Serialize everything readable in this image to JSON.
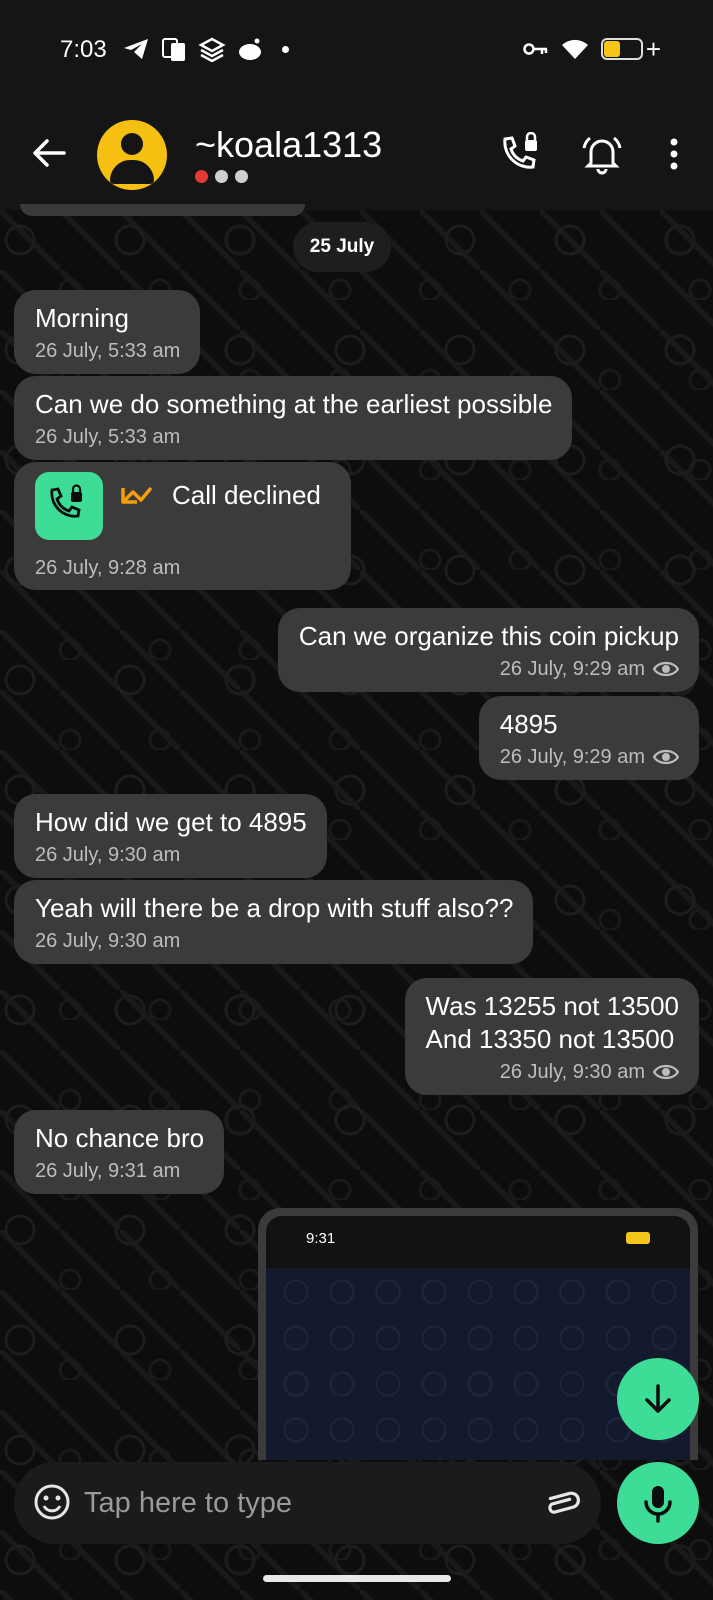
{
  "status_bar": {
    "time": "7:03"
  },
  "header": {
    "contact_name": "~koala1313"
  },
  "date_chip": "25 July",
  "messages": [
    {
      "dir": "in",
      "text": "Morning",
      "time": "26 July, 5:33 am"
    },
    {
      "dir": "in",
      "text": "Can we do something at the earliest possible",
      "time": "26 July, 5:33 am"
    },
    {
      "dir": "in",
      "type": "call",
      "text": "Call declined",
      "time": "26 July, 9:28 am"
    },
    {
      "dir": "out",
      "text": "Can we organize this coin pickup",
      "time": "26 July, 9:29 am",
      "seen": true
    },
    {
      "dir": "out",
      "text": "4895",
      "time": "26 July, 9:29 am",
      "seen": true
    },
    {
      "dir": "in",
      "text": "How did we get to 4895",
      "time": "26 July, 9:30 am"
    },
    {
      "dir": "in",
      "text": "Yeah will there be a drop with stuff also??",
      "time": "26 July, 9:30 am"
    },
    {
      "dir": "out",
      "text": "Was 13255 not 13500\nAnd 13350 not 13500",
      "time": "26 July, 9:30 am",
      "seen": true
    },
    {
      "dir": "in",
      "text": "No chance bro",
      "time": "26 July, 9:31 am"
    },
    {
      "dir": "out",
      "type": "image",
      "status_time": "9:31"
    }
  ],
  "composer": {
    "placeholder": "Tap here to type"
  },
  "colors": {
    "accent": "#3ddc97",
    "avatar": "#f6c012",
    "bubble": "#3b3b3b",
    "declined_arrow": "#f59e0b"
  },
  "icons": {
    "back": "back-arrow-icon",
    "call": "secure-call-icon",
    "notifications": "bell-icon",
    "more": "more-vertical-icon",
    "seen": "eye-icon",
    "emoji": "emoji-icon",
    "attach": "paperclip-icon",
    "mic": "microphone-icon",
    "scroll_down": "arrow-down-icon"
  }
}
